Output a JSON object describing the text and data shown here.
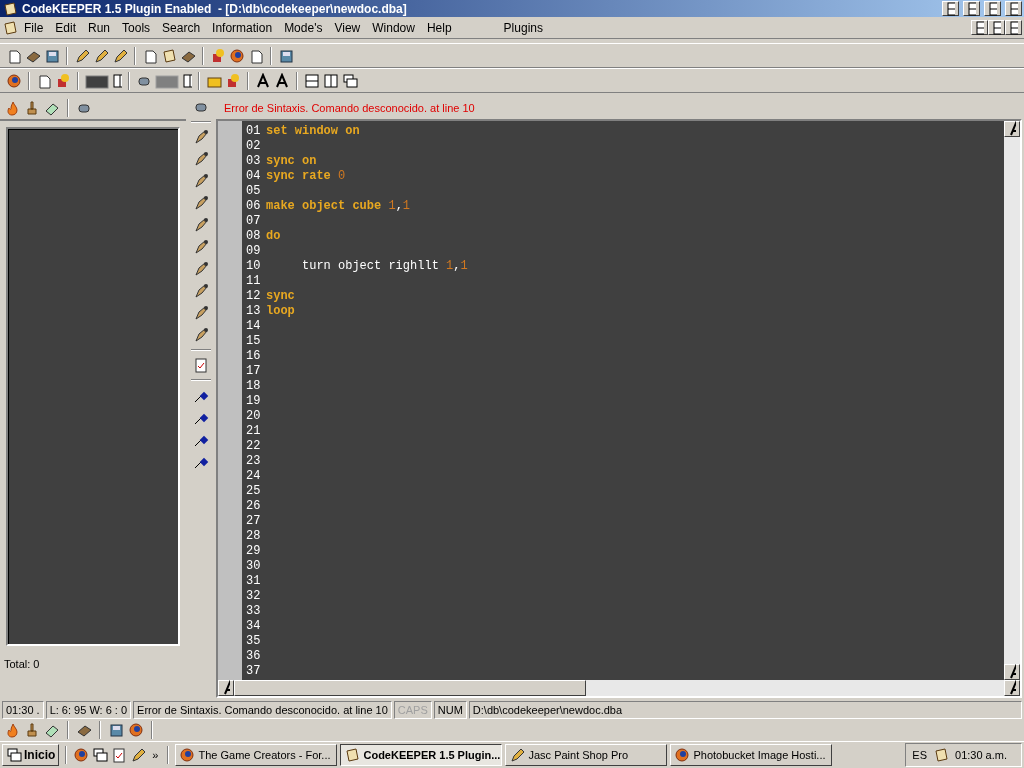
{
  "window": {
    "title": "CodeKEEPER 1.5 Plugin Enabled  - [D:\\db\\codekeeper\\newdoc.dba]"
  },
  "menu": {
    "items": [
      "File",
      "Edit",
      "Run",
      "Tools",
      "Search",
      "Information",
      "Mode's",
      "View",
      "Window",
      "Help"
    ],
    "plugins": "Plugins"
  },
  "error_bar": {
    "message": "Error de Sintaxis. Comando desconocido. at line 10"
  },
  "left_panel": {
    "total": "Total: 0"
  },
  "editor": {
    "lines": [
      {
        "num": "01",
        "tokens": [
          {
            "kind": "keyword",
            "text": "set window on"
          }
        ]
      },
      {
        "num": "02"
      },
      {
        "num": "03",
        "tokens": [
          {
            "kind": "keyword",
            "text": "sync on"
          }
        ]
      },
      {
        "num": "04",
        "tokens": [
          {
            "kind": "keyword",
            "text": "sync rate "
          },
          {
            "kind": "number",
            "text": "0"
          }
        ]
      },
      {
        "num": "05"
      },
      {
        "num": "06",
        "tokens": [
          {
            "kind": "keyword",
            "text": "make object cube "
          },
          {
            "kind": "number",
            "text": "1"
          },
          {
            "kind": "plain",
            "text": ","
          },
          {
            "kind": "number",
            "text": "1"
          }
        ]
      },
      {
        "num": "07"
      },
      {
        "num": "08",
        "tokens": [
          {
            "kind": "keyword",
            "text": "do"
          }
        ]
      },
      {
        "num": "09"
      },
      {
        "num": "10",
        "tokens": [
          {
            "kind": "plain",
            "text": "     turn object righllt "
          },
          {
            "kind": "number",
            "text": "1"
          },
          {
            "kind": "plain",
            "text": ","
          },
          {
            "kind": "number",
            "text": "1"
          }
        ]
      },
      {
        "num": "11"
      },
      {
        "num": "12",
        "tokens": [
          {
            "kind": "keyword",
            "text": "sync"
          }
        ]
      },
      {
        "num": "13",
        "tokens": [
          {
            "kind": "keyword",
            "text": "loop"
          }
        ]
      },
      {
        "num": "14"
      },
      {
        "num": "15"
      },
      {
        "num": "16"
      },
      {
        "num": "17"
      },
      {
        "num": "18"
      },
      {
        "num": "19"
      },
      {
        "num": "20"
      },
      {
        "num": "21"
      },
      {
        "num": "22"
      },
      {
        "num": "23"
      },
      {
        "num": "24"
      },
      {
        "num": "25"
      },
      {
        "num": "26"
      },
      {
        "num": "27"
      },
      {
        "num": "28"
      },
      {
        "num": "29"
      },
      {
        "num": "30"
      },
      {
        "num": "31"
      },
      {
        "num": "32"
      },
      {
        "num": "33"
      },
      {
        "num": "34"
      },
      {
        "num": "35"
      },
      {
        "num": "36"
      },
      {
        "num": "37"
      }
    ]
  },
  "status_bar": {
    "panels": [
      {
        "text": "01:30 .",
        "active": true
      },
      {
        "text": "L: 6: 95 W: 6 :  0",
        "active": true
      },
      {
        "text": "Error de Sintaxis. Comando desconocido. at line 10",
        "active": true
      },
      {
        "text": "CAPS",
        "active": false
      },
      {
        "text": "NUM",
        "active": true
      },
      {
        "text": "D:\\db\\codekeeper\\newdoc.dba",
        "active": true
      }
    ]
  },
  "taskbar": {
    "start": "Inicio",
    "more": "»",
    "tasks": [
      {
        "label": "The Game Creators - For...",
        "selected": false
      },
      {
        "label": "CodeKEEPER 1.5 Plugin...",
        "selected": true
      },
      {
        "label": "Jasc Paint Shop Pro",
        "selected": false
      },
      {
        "label": "Photobucket Image Hosti...",
        "selected": false
      }
    ],
    "language": "ES",
    "clock": "01:30 a.m."
  }
}
